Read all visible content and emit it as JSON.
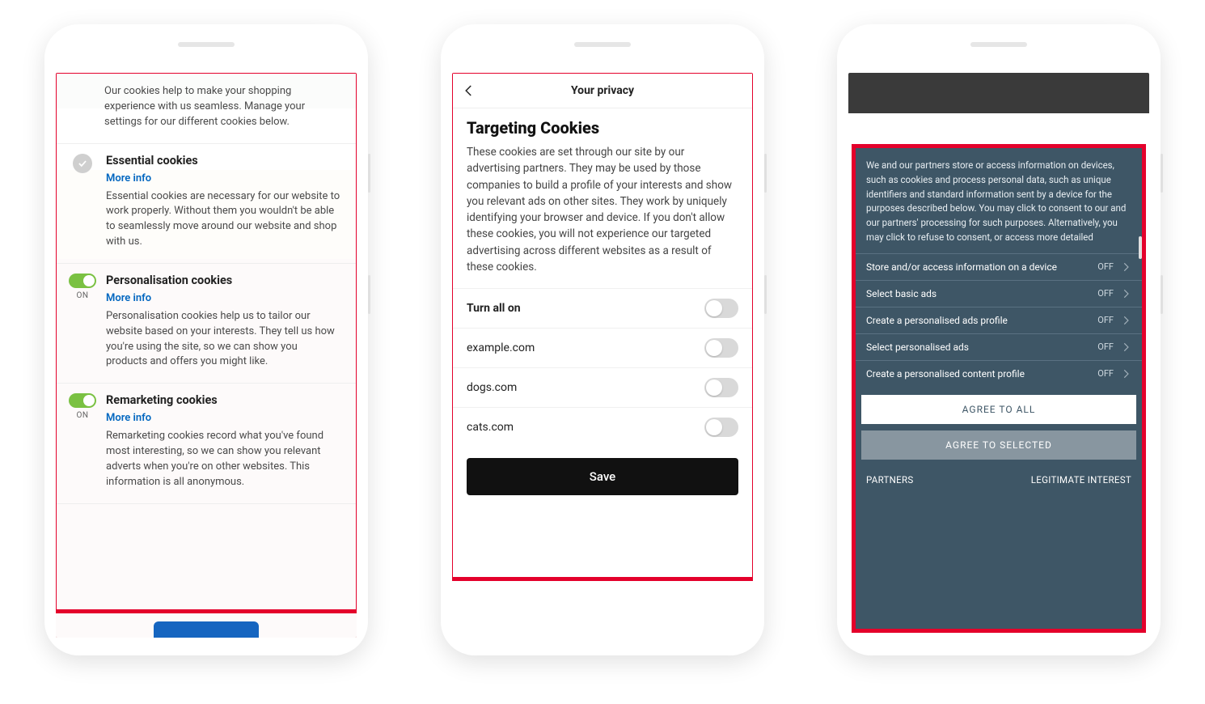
{
  "phone1": {
    "intro": "Our cookies help to make your shopping experience with us seamless. Manage your settings for our different cookies below.",
    "more_info_label": "More info",
    "on_label": "ON",
    "items": [
      {
        "title": "Essential cookies",
        "desc": "Essential cookies are necessary for our website to work properly. Without them you wouldn't be able to seamlessly move around our website and shop with us."
      },
      {
        "title": "Personalisation cookies",
        "desc": "Personalisation cookies help us to tailor our website based on your interests. They tell us how you're using the site, so we can show you products and offers you might like."
      },
      {
        "title": "Remarketing cookies",
        "desc": "Remarketing cookies record what you've found most interesting, so we can show you relevant adverts when you're on other websites. This information is all anonymous."
      }
    ]
  },
  "phone2": {
    "header_title": "Your privacy",
    "section_title": "Targeting Cookies",
    "section_desc": "These cookies are set through our site by our advertising partners. They may be used by those companies to build a profile of your interests and show you relevant ads on other sites. They work by uniquely identifying your browser and device. If you don't allow these cookies, you will not experience our targeted advertising across different websites as a result of these cookies.",
    "turn_all_label": "Turn all on",
    "rows": [
      {
        "label": "example.com"
      },
      {
        "label": "dogs.com"
      },
      {
        "label": "cats.com"
      }
    ],
    "save_label": "Save"
  },
  "phone3": {
    "intro": "We and our partners store or access information on devices, such as cookies and process personal data, such as unique identifiers and standard information sent by a device for the purposes described below. You may click to consent to our and our partners' processing for such purposes. Alternatively, you may click to refuse to consent, or access more detailed",
    "off_label": "OFF",
    "rows": [
      {
        "label": "Store and/or access information on a device"
      },
      {
        "label": "Select basic ads"
      },
      {
        "label": "Create a personalised ads profile"
      },
      {
        "label": "Select personalised ads"
      },
      {
        "label": "Create a personalised content profile"
      }
    ],
    "agree_all": "AGREE TO ALL",
    "agree_selected": "AGREE TO SELECTED",
    "partners": "PARTNERS",
    "legit_interest": "LEGITIMATE INTEREST"
  }
}
